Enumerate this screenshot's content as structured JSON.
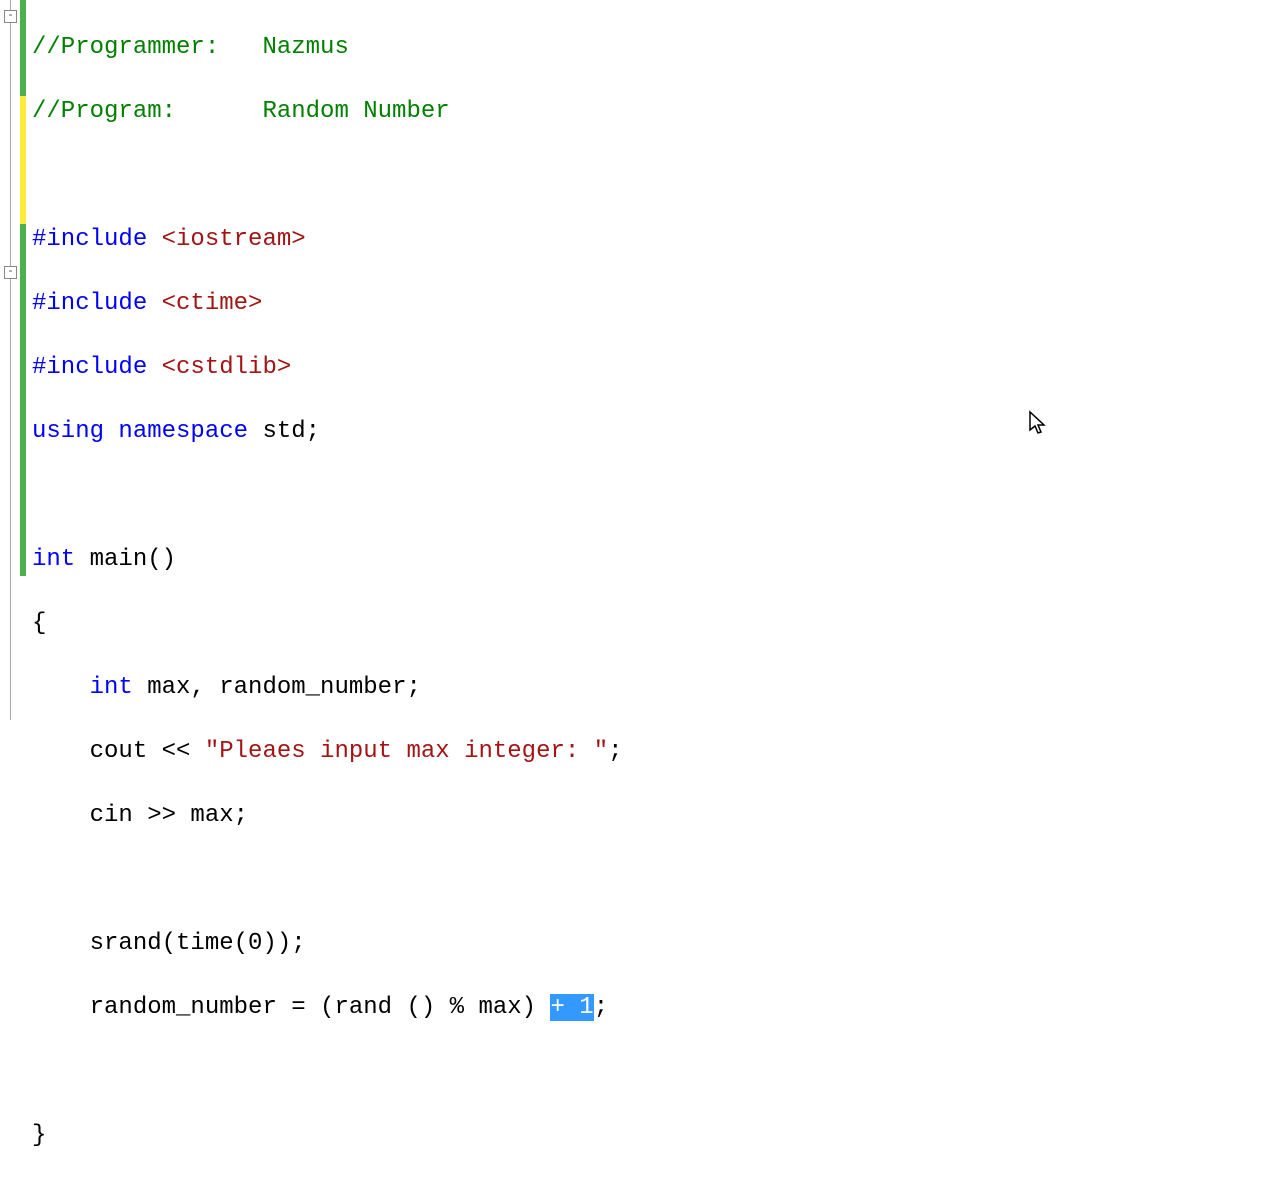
{
  "fold": {
    "minus": "-"
  },
  "code": {
    "l1": {
      "comment": "//Programmer:   Nazmus"
    },
    "l2": {
      "comment": "//Program:      Random Number"
    },
    "l3": {},
    "l4": {
      "pp": "#include ",
      "pparg": "<iostream>"
    },
    "l5": {
      "pp": "#include ",
      "pparg": "<ctime>"
    },
    "l6": {
      "pp": "#include ",
      "pparg": "<cstdlib>"
    },
    "l7": {
      "kw1": "using",
      "sp1": " ",
      "kw2": "namespace",
      "sp2": " ",
      "id": "std;"
    },
    "l8": {},
    "l9": {
      "kw": "int",
      "rest": " main()"
    },
    "l10": {
      "text": "{"
    },
    "l11": {
      "indent": "    ",
      "kw": "int",
      "rest": " max, random_number;"
    },
    "l12": {
      "indent": "    ",
      "id1": "cout << ",
      "str": "\"Pleaes input max integer: \"",
      "id2": ";"
    },
    "l13": {
      "indent": "    ",
      "text": "cin >> max;"
    },
    "l14": {},
    "l15": {
      "indent": "    ",
      "text": "srand(time(0));"
    },
    "l16": {
      "indent": "    ",
      "before": "random_number = (rand () % max) ",
      "sel": "+ 1",
      "after": ";"
    },
    "l17": {},
    "l18": {
      "text": "}"
    }
  }
}
